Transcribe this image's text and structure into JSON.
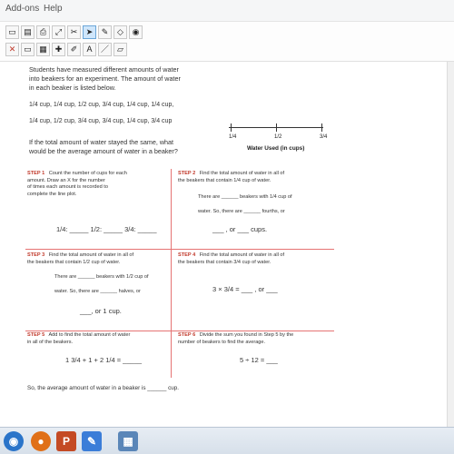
{
  "menubar": {
    "items": [
      "Add-ons",
      "Help"
    ]
  },
  "toolbar": {
    "row1_icons": [
      "document-icon",
      "pages-icon",
      "print-icon",
      "expand-icon",
      "crop-icon",
      "pointer-icon",
      "pen-icon",
      "eraser-icon",
      "paint-icon"
    ],
    "row2_icons": [
      "close-icon",
      "screen-icon",
      "grid-icon",
      "new-icon",
      "highlighter-icon",
      "text-icon",
      "line-icon",
      "eraser2-icon"
    ]
  },
  "problem": {
    "lines": [
      "Students have measured different amounts of water",
      "into beakers for an experiment. The amount of water",
      "in each beaker is listed below."
    ],
    "cup_rows": [
      [
        "1/4 cup,",
        "1/4 cup,",
        "1/2 cup,",
        "3/4 cup,",
        "1/4 cup,",
        "1/4 cup,"
      ],
      [
        "1/4 cup,",
        "1/2 cup,",
        "3/4 cup,",
        "3/4 cup,",
        "1/4 cup,",
        "3/4 cup"
      ]
    ],
    "question": [
      "If the total amount of water stayed the same, what",
      "would be the average amount of water in a beaker?"
    ]
  },
  "lineplot": {
    "labels": [
      "1/4",
      "1/2",
      "3/4"
    ],
    "title": "Water Used (in cups)"
  },
  "steps": {
    "step1": {
      "label": "STEP 1",
      "text": [
        "Count the number of cups for each",
        "amount. Draw an X for the number",
        "of times each amount is recorded to",
        "complete the line plot."
      ],
      "blanks": "1/4: _____  1/2: _____  3/4: _____"
    },
    "step2": {
      "label": "STEP 2",
      "text": [
        "Find the total amount of water in all of",
        "the beakers that contain 1/4 cup of water."
      ],
      "line1": "There are ______ beakers with 1/4 cup of",
      "line2": "water. So, there are ______ fourths, or",
      "math": "___ , or ___ cups."
    },
    "step3": {
      "label": "STEP 3",
      "text": [
        "Find the total amount of water in all of",
        "the beakers that contain 1/2 cup of water."
      ],
      "line1": "There are ______ beakers with 1/2 cup of",
      "line2": "water. So, there are ______ halves, or",
      "math": "___, or 1 cup."
    },
    "step4": {
      "label": "STEP 4",
      "text": [
        "Find the total amount of water in all of",
        "the beakers that contain 3/4 cup of water."
      ],
      "math": "3 × 3/4 = ___ , or ___"
    },
    "step5": {
      "label": "STEP 5",
      "text": [
        "Add to find the total amount of water",
        "in all of the beakers."
      ],
      "math": "1 3/4 + 1 + 2 1/4 = _____"
    },
    "step6": {
      "label": "STEP 6",
      "text": [
        "Divide the sum you found in Step 5 by the",
        "number of beakers to find the average."
      ],
      "math": "5 ÷ 12 = ___"
    }
  },
  "answer": "So, the average amount of water in a beaker is ______ cup.",
  "taskbar": {
    "apps": [
      "firefox",
      "powerpoint",
      "journal",
      "app"
    ]
  }
}
